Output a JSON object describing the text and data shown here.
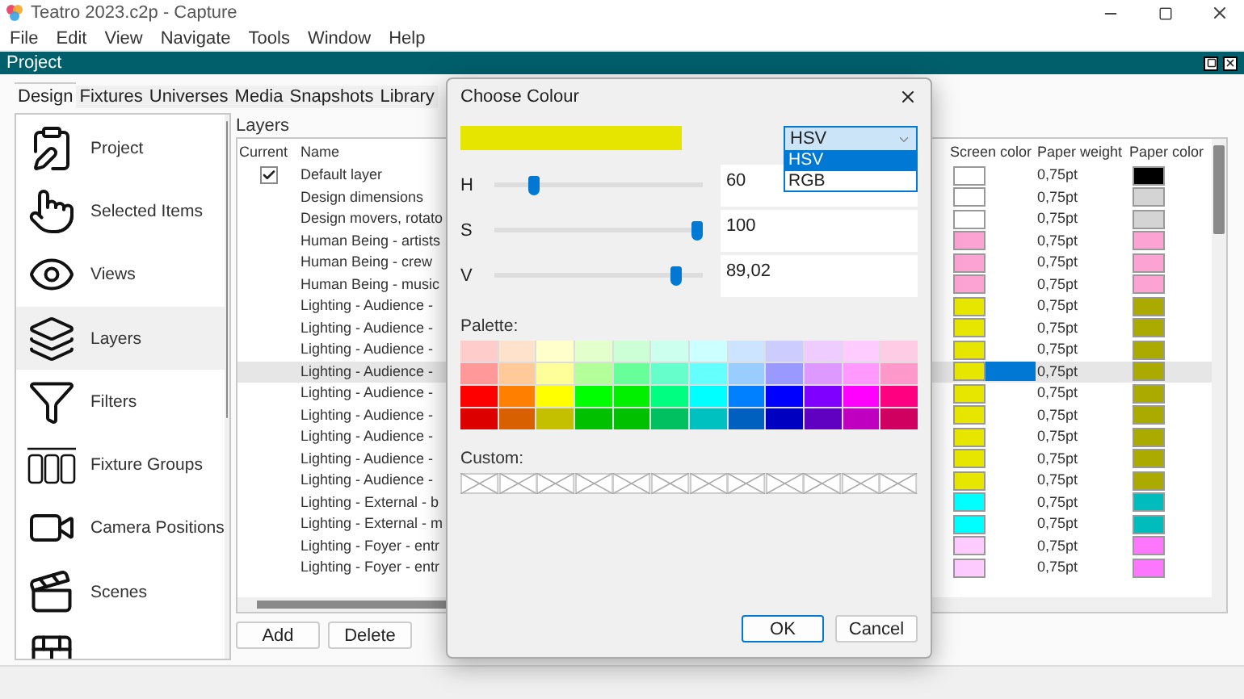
{
  "window": {
    "title": "Teatro 2023.c2p - Capture"
  },
  "menu": [
    "File",
    "Edit",
    "View",
    "Navigate",
    "Tools",
    "Window",
    "Help"
  ],
  "project_bar": {
    "title": "Project"
  },
  "tabs": [
    {
      "label": "Design",
      "selected": true
    },
    {
      "label": "Fixtures",
      "selected": false
    },
    {
      "label": "Universes",
      "selected": false
    },
    {
      "label": "Media",
      "selected": false
    },
    {
      "label": "Snapshots",
      "selected": false
    },
    {
      "label": "Library",
      "selected": false
    }
  ],
  "sidebar": {
    "items": [
      {
        "label": "Project",
        "kind": "project",
        "selected": false
      },
      {
        "label": "Selected Items",
        "kind": "selection",
        "selected": false
      },
      {
        "label": "Views",
        "kind": "views",
        "selected": false
      },
      {
        "label": "Layers",
        "kind": "layers",
        "selected": true
      },
      {
        "label": "Filters",
        "kind": "filters",
        "selected": false
      },
      {
        "label": "Fixture Groups",
        "kind": "fixtures",
        "selected": false
      },
      {
        "label": "Camera Positions",
        "kind": "camera",
        "selected": false
      },
      {
        "label": "Scenes",
        "kind": "scenes",
        "selected": false
      },
      {
        "kind": "materials",
        "selected": false
      }
    ]
  },
  "layers": {
    "title": "Layers",
    "columns": [
      "Current",
      "Name",
      "Screen color",
      "Paper weight",
      "Paper color"
    ],
    "rows": [
      {
        "current": true,
        "selected": false,
        "name": "Default layer",
        "screen_color": {
          "color": "#ffffff"
        },
        "paper_weight": "0,75pt",
        "paper_color": {
          "color": "#000000"
        }
      },
      {
        "current": false,
        "selected": false,
        "name": "Design dimensions",
        "screen_color": {
          "color": "#ffffff"
        },
        "paper_weight": "0,75pt",
        "paper_color": {
          "color": "#d4d4d4"
        }
      },
      {
        "current": false,
        "selected": false,
        "name": "Design movers, rotato",
        "screen_color": {
          "color": "#ffffff"
        },
        "paper_weight": "0,75pt",
        "paper_color": {
          "color": "#d4d4d4"
        }
      },
      {
        "current": false,
        "selected": false,
        "name": "Human Being - artists",
        "screen_color": {
          "color": "#fca3d4"
        },
        "paper_weight": "0,75pt",
        "paper_color": {
          "color": "#fca3d4"
        }
      },
      {
        "current": false,
        "selected": false,
        "name": "Human Being - crew",
        "screen_color": {
          "color": "#fca3d4"
        },
        "paper_weight": "0,75pt",
        "paper_color": {
          "color": "#fca3d4"
        }
      },
      {
        "current": false,
        "selected": false,
        "name": "Human Being - music",
        "screen_color": {
          "color": "#fca3d4"
        },
        "paper_weight": "0,75pt",
        "paper_color": {
          "color": "#fca3d4"
        }
      },
      {
        "current": false,
        "selected": false,
        "name": "Lighting - Audience -",
        "screen_color": {
          "color": "#e6e600"
        },
        "paper_weight": "0,75pt",
        "paper_color": {
          "color": "#aaaa00"
        }
      },
      {
        "current": false,
        "selected": false,
        "name": "Lighting - Audience -",
        "screen_color": {
          "color": "#e6e600"
        },
        "paper_weight": "0,75pt",
        "paper_color": {
          "color": "#aaaa00"
        }
      },
      {
        "current": false,
        "selected": false,
        "name": "Lighting - Audience -",
        "screen_color": {
          "color": "#e6e600"
        },
        "paper_weight": "0,75pt",
        "paper_color": {
          "color": "#aaaa00"
        }
      },
      {
        "current": false,
        "selected": true,
        "name": "Lighting - Audience -",
        "screen_color": {
          "color": "#e6e600"
        },
        "paper_weight": "0,75pt",
        "paper_color": {
          "color": "#aaaa00"
        }
      },
      {
        "current": false,
        "selected": false,
        "name": "Lighting - Audience -",
        "screen_color": {
          "color": "#e6e600"
        },
        "paper_weight": "0,75pt",
        "paper_color": {
          "color": "#aaaa00"
        }
      },
      {
        "current": false,
        "selected": false,
        "name": "Lighting - Audience -",
        "screen_color": {
          "color": "#e6e600"
        },
        "paper_weight": "0,75pt",
        "paper_color": {
          "color": "#aaaa00"
        }
      },
      {
        "current": false,
        "selected": false,
        "name": "Lighting - Audience -",
        "screen_color": {
          "color": "#e6e600"
        },
        "paper_weight": "0,75pt",
        "paper_color": {
          "color": "#aaaa00"
        }
      },
      {
        "current": false,
        "selected": false,
        "name": "Lighting - Audience -",
        "screen_color": {
          "color": "#e6e600"
        },
        "paper_weight": "0,75pt",
        "paper_color": {
          "color": "#aaaa00"
        }
      },
      {
        "current": false,
        "selected": false,
        "name": "Lighting - Audience -",
        "screen_color": {
          "color": "#e6e600"
        },
        "paper_weight": "0,75pt",
        "paper_color": {
          "color": "#aaaa00"
        }
      },
      {
        "current": false,
        "selected": false,
        "name": "Lighting - External - b",
        "screen_color": {
          "color": "#00ffff"
        },
        "paper_weight": "0,75pt",
        "paper_color": {
          "color": "#00bcbc"
        }
      },
      {
        "current": false,
        "selected": false,
        "name": "Lighting - External - m",
        "screen_color": {
          "color": "#00ffff"
        },
        "paper_weight": "0,75pt",
        "paper_color": {
          "color": "#00bcbc"
        }
      },
      {
        "current": false,
        "selected": false,
        "name": "Lighting - Foyer - entr",
        "screen_color": {
          "color": "#ffccff"
        },
        "paper_weight": "0,75pt",
        "paper_color": {
          "color": "#ff77ff"
        }
      },
      {
        "current": false,
        "selected": false,
        "name": "Lighting - Foyer - entr",
        "screen_color": {
          "color": "#ffccff"
        },
        "paper_weight": "0,75pt",
        "paper_color": {
          "color": "#ff77ff"
        }
      }
    ],
    "buttons": [
      "Add",
      "Delete"
    ]
  },
  "dialog": {
    "title": "Choose Colour",
    "preview": {
      "color": "#e5e500"
    },
    "mode_select": {
      "value": "HSV",
      "expanded": true,
      "options": [
        {
          "label": "HSV",
          "selected": true
        },
        {
          "label": "RGB",
          "selected": false
        }
      ]
    },
    "channels": [
      {
        "label": "H",
        "level": 0.17,
        "value": "60"
      },
      {
        "label": "S",
        "level": 1,
        "value": "100"
      },
      {
        "label": "V",
        "level": 0.89,
        "value": "89,02"
      }
    ],
    "palette_label": "Palette:",
    "palette": [
      [
        {
          "color": "#ffcccc"
        },
        {
          "color": "#ffe2cc"
        },
        {
          "color": "#ffffcc"
        },
        {
          "color": "#e2ffcc"
        },
        {
          "color": "#ccffd6"
        },
        {
          "color": "#ccffee"
        },
        {
          "color": "#ccffff"
        },
        {
          "color": "#cce4ff"
        },
        {
          "color": "#ccccff"
        },
        {
          "color": "#eeccff"
        },
        {
          "color": "#ffccff"
        },
        {
          "color": "#ffcce6"
        }
      ],
      [
        {
          "color": "#ff9999"
        },
        {
          "color": "#ffc999"
        },
        {
          "color": "#ffff99"
        },
        {
          "color": "#b3ff99"
        },
        {
          "color": "#66ff99"
        },
        {
          "color": "#66ffcc"
        },
        {
          "color": "#66ffff"
        },
        {
          "color": "#99ccff"
        },
        {
          "color": "#9999ff"
        },
        {
          "color": "#dd99ff"
        },
        {
          "color": "#ff99ff"
        },
        {
          "color": "#ff99cc"
        }
      ],
      [
        {
          "color": "#ff0000"
        },
        {
          "color": "#ff8000"
        },
        {
          "color": "#ffff00"
        },
        {
          "color": "#00ff00"
        },
        {
          "color": "#00f000"
        },
        {
          "color": "#00ff80"
        },
        {
          "color": "#00ffff"
        },
        {
          "color": "#0080ff"
        },
        {
          "color": "#0000ff"
        },
        {
          "color": "#8000ff"
        },
        {
          "color": "#ff00ff"
        },
        {
          "color": "#ff0080"
        }
      ],
      [
        {
          "color": "#dd0000"
        },
        {
          "color": "#d96000"
        },
        {
          "color": "#c4c000"
        },
        {
          "color": "#00c000"
        },
        {
          "color": "#00c000"
        },
        {
          "color": "#00c060"
        },
        {
          "color": "#00c0c0"
        },
        {
          "color": "#0060c0"
        },
        {
          "color": "#0000c0"
        },
        {
          "color": "#6000c0"
        },
        {
          "color": "#c000c0"
        },
        {
          "color": "#d00060"
        }
      ]
    ],
    "custom_label": "Custom:",
    "buttons": [
      {
        "label": "OK",
        "kind": "default"
      },
      {
        "label": "Cancel",
        "kind": "normal"
      }
    ]
  }
}
